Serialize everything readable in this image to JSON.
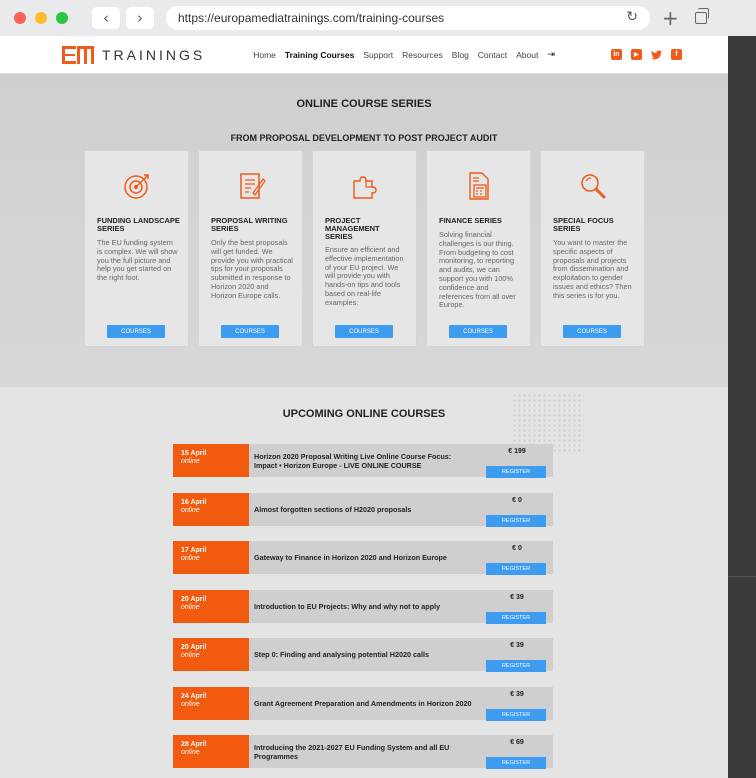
{
  "browser": {
    "url": "https://europamediatrainings.com/training-courses",
    "back": "‹",
    "forward": "›",
    "reload": "↻",
    "plus": "+",
    "lights": [
      "#fe5f57",
      "#febc2e",
      "#28c840"
    ]
  },
  "site": {
    "logo_text": "TRAININGS",
    "nav": [
      "Home",
      "Training Courses",
      "Support",
      "Resources",
      "Blog",
      "Contact",
      "About"
    ],
    "login_icon": "⇥",
    "socials": [
      "in",
      "▶",
      "🐦",
      "f"
    ],
    "brand_color": "#f05a1a"
  },
  "series": {
    "title": "ONLINE COURSE SERIES",
    "subtitle": "FROM PROPOSAL DEVELOPMENT TO POST PROJECT AUDIT",
    "cards": [
      {
        "icon": "target-icon",
        "title": "FUNDING LANDSCAPE SERIES",
        "text": "The EU funding system is complex. We will show you the full picture and help you get started on the right foot.",
        "button": "COURSES"
      },
      {
        "icon": "document-pencil-icon",
        "title": "PROPOSAL WRITING SERIES",
        "text": "Only the best proposals will get funded. We provide you with practical tips for your proposals submitted in response to Horizon 2020 and Horizon Europe calls.",
        "button": "COURSES"
      },
      {
        "icon": "puzzle-icon",
        "title": "PROJECT MANAGEMENT SERIES",
        "text": "Ensure an efficient and effective implementation of your EU project. We will provide you with hands-on tips and tools based on real-life examples.",
        "button": "COURSES"
      },
      {
        "icon": "calculator-document-icon",
        "title": "FINANCE SERIES",
        "text": "Solving financial challenges is our thing. From budgeting to cost monitoring, to reporting and audits, we can support you with 100% confidence and references from all over Europe.",
        "button": "COURSES"
      },
      {
        "icon": "magnifier-icon",
        "title": "SPECIAL FOCUS SERIES",
        "text": "You want to master the specific aspects of proposals and projects from dissemination and exploitation to gender issues and ethics? Then this series is for you.",
        "button": "COURSES"
      }
    ]
  },
  "upcoming": {
    "title": "UPCOMING ONLINE COURSES",
    "courses": [
      {
        "date": "15 April",
        "mode": "online",
        "title": "Horizon 2020 Proposal Writing Live Online Course Focus: Impact • Horizon Europe - LIVE ONLINE COURSE",
        "price": "€ 199",
        "button": "REGISTER"
      },
      {
        "date": "16 April",
        "mode": "online",
        "title": "Almost forgotten sections of H2020 proposals",
        "price": "€ 0",
        "button": "REGISTER"
      },
      {
        "date": "17 April",
        "mode": "online",
        "title": "Gateway to Finance in Horizon 2020 and Horizon Europe",
        "price": "€ 0",
        "button": "REGISTER"
      },
      {
        "date": "20 April",
        "mode": "online",
        "title": "Introduction to EU Projects: Why and why not to apply",
        "price": "€ 39",
        "button": "REGISTER"
      },
      {
        "date": "20 April",
        "mode": "online",
        "title": "Step 0: Finding and analysing potential H2020 calls",
        "price": "€ 39",
        "button": "REGISTER"
      },
      {
        "date": "24 April",
        "mode": "online",
        "title": "Grant Agreement Preparation and Amendments in Horizon 2020",
        "price": "€ 39",
        "button": "REGISTER"
      },
      {
        "date": "28 April",
        "mode": "online",
        "title": "Introducing the 2021-2027 EU Funding System and all EU Programmes",
        "price": "€ 69",
        "button": "REGISTER"
      }
    ]
  }
}
